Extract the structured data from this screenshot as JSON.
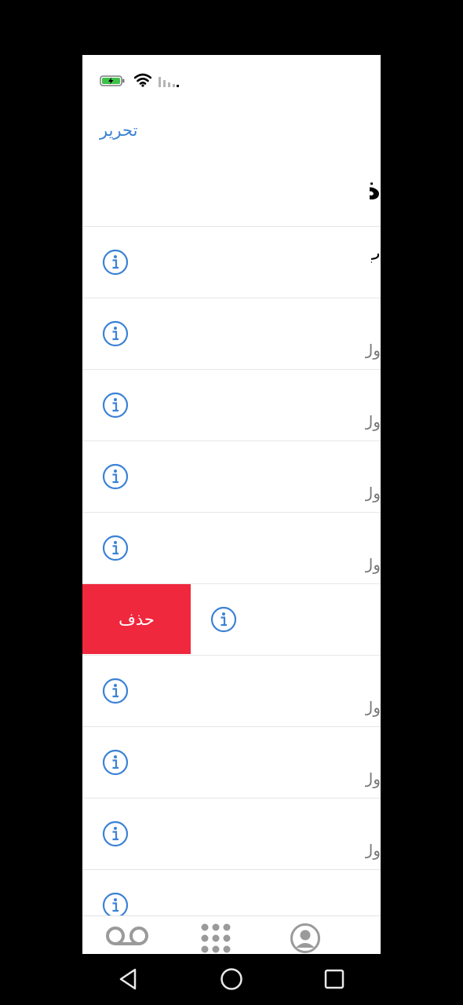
{
  "status": {
    "battery_icon": "battery-charging-icon",
    "wifi_icon": "wifi-icon",
    "signal_icon": "signal-icon"
  },
  "header": {
    "edit_label": "تحرير",
    "title_fragment": "ة"
  },
  "rows": [
    {
      "title": "ب",
      "subtitle": ""
    },
    {
      "title": "",
      "subtitle": "ول"
    },
    {
      "title": "",
      "subtitle": "ول"
    },
    {
      "title": "",
      "subtitle": "ول"
    },
    {
      "title": "",
      "subtitle": "ول"
    },
    {
      "title": "",
      "subtitle": "",
      "delete_label": "حذف"
    },
    {
      "title": "",
      "subtitle": "ول"
    },
    {
      "title": "",
      "subtitle": "ول"
    },
    {
      "title": "",
      "subtitle": "ول"
    },
    {
      "title": "",
      "subtitle": ""
    }
  ],
  "colors": {
    "accent": "#3b82d6",
    "delete": "#f0283d",
    "tab_icon": "#9a9a9a"
  },
  "tabs": [
    "voicemail-icon",
    "keypad-icon",
    "contacts-icon"
  ],
  "nav": [
    "back-icon",
    "home-icon",
    "recents-icon"
  ]
}
